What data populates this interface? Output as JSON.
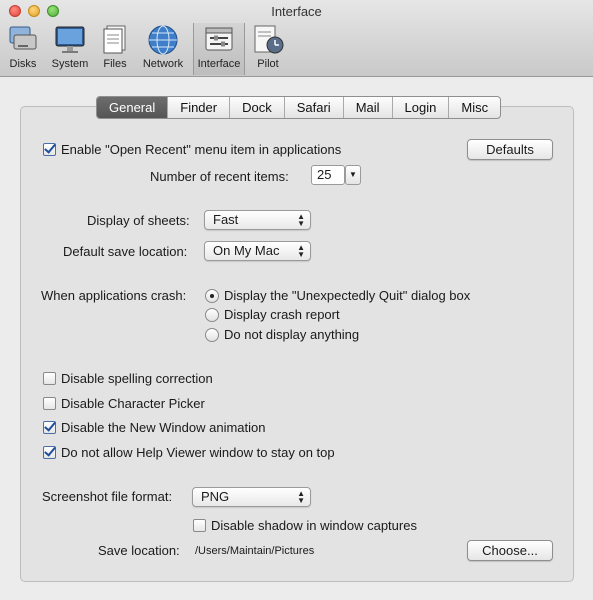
{
  "window": {
    "title": "Interface"
  },
  "toolbar": {
    "items": [
      {
        "label": "Disks",
        "icon": "disks-icon"
      },
      {
        "label": "System",
        "icon": "system-icon"
      },
      {
        "label": "Files",
        "icon": "files-icon"
      },
      {
        "label": "Network",
        "icon": "network-icon"
      },
      {
        "label": "Interface",
        "icon": "interface-icon",
        "selected": true
      },
      {
        "label": "Pilot",
        "icon": "pilot-icon"
      }
    ]
  },
  "tabs": [
    {
      "label": "General",
      "active": true
    },
    {
      "label": "Finder"
    },
    {
      "label": "Dock"
    },
    {
      "label": "Safari"
    },
    {
      "label": "Mail"
    },
    {
      "label": "Login"
    },
    {
      "label": "Misc"
    }
  ],
  "general": {
    "open_recent": {
      "label": "Enable \"Open Recent\" menu item in applications",
      "checked": true
    },
    "defaults_button": "Defaults",
    "recent_items": {
      "label": "Number of recent items:",
      "value": "25"
    },
    "sheets": {
      "label": "Display of sheets:",
      "value": "Fast"
    },
    "save_location": {
      "label": "Default save location:",
      "value": "On My Mac"
    },
    "crash": {
      "label": "When applications crash:",
      "options": [
        {
          "label": "Display the \"Unexpectedly Quit\" dialog box",
          "selected": true
        },
        {
          "label": "Display crash report",
          "selected": false
        },
        {
          "label": "Do not display anything",
          "selected": false
        }
      ]
    },
    "checkboxes": [
      {
        "label": "Disable spelling correction",
        "checked": false
      },
      {
        "label": "Disable Character Picker",
        "checked": false
      },
      {
        "label": "Disable the New Window animation",
        "checked": true
      },
      {
        "label": "Do not allow Help Viewer window to stay on top",
        "checked": true
      }
    ],
    "screenshot_format": {
      "label": "Screenshot file format:",
      "value": "PNG"
    },
    "disable_shadow": {
      "label": "Disable shadow in window captures",
      "checked": false
    },
    "screenshot_save": {
      "label": "Save location:",
      "path": "/Users/Maintain/Pictures",
      "button": "Choose..."
    }
  },
  "colors": {
    "accent": "#1f4e9e",
    "tab_active": "#5e5e5e"
  }
}
